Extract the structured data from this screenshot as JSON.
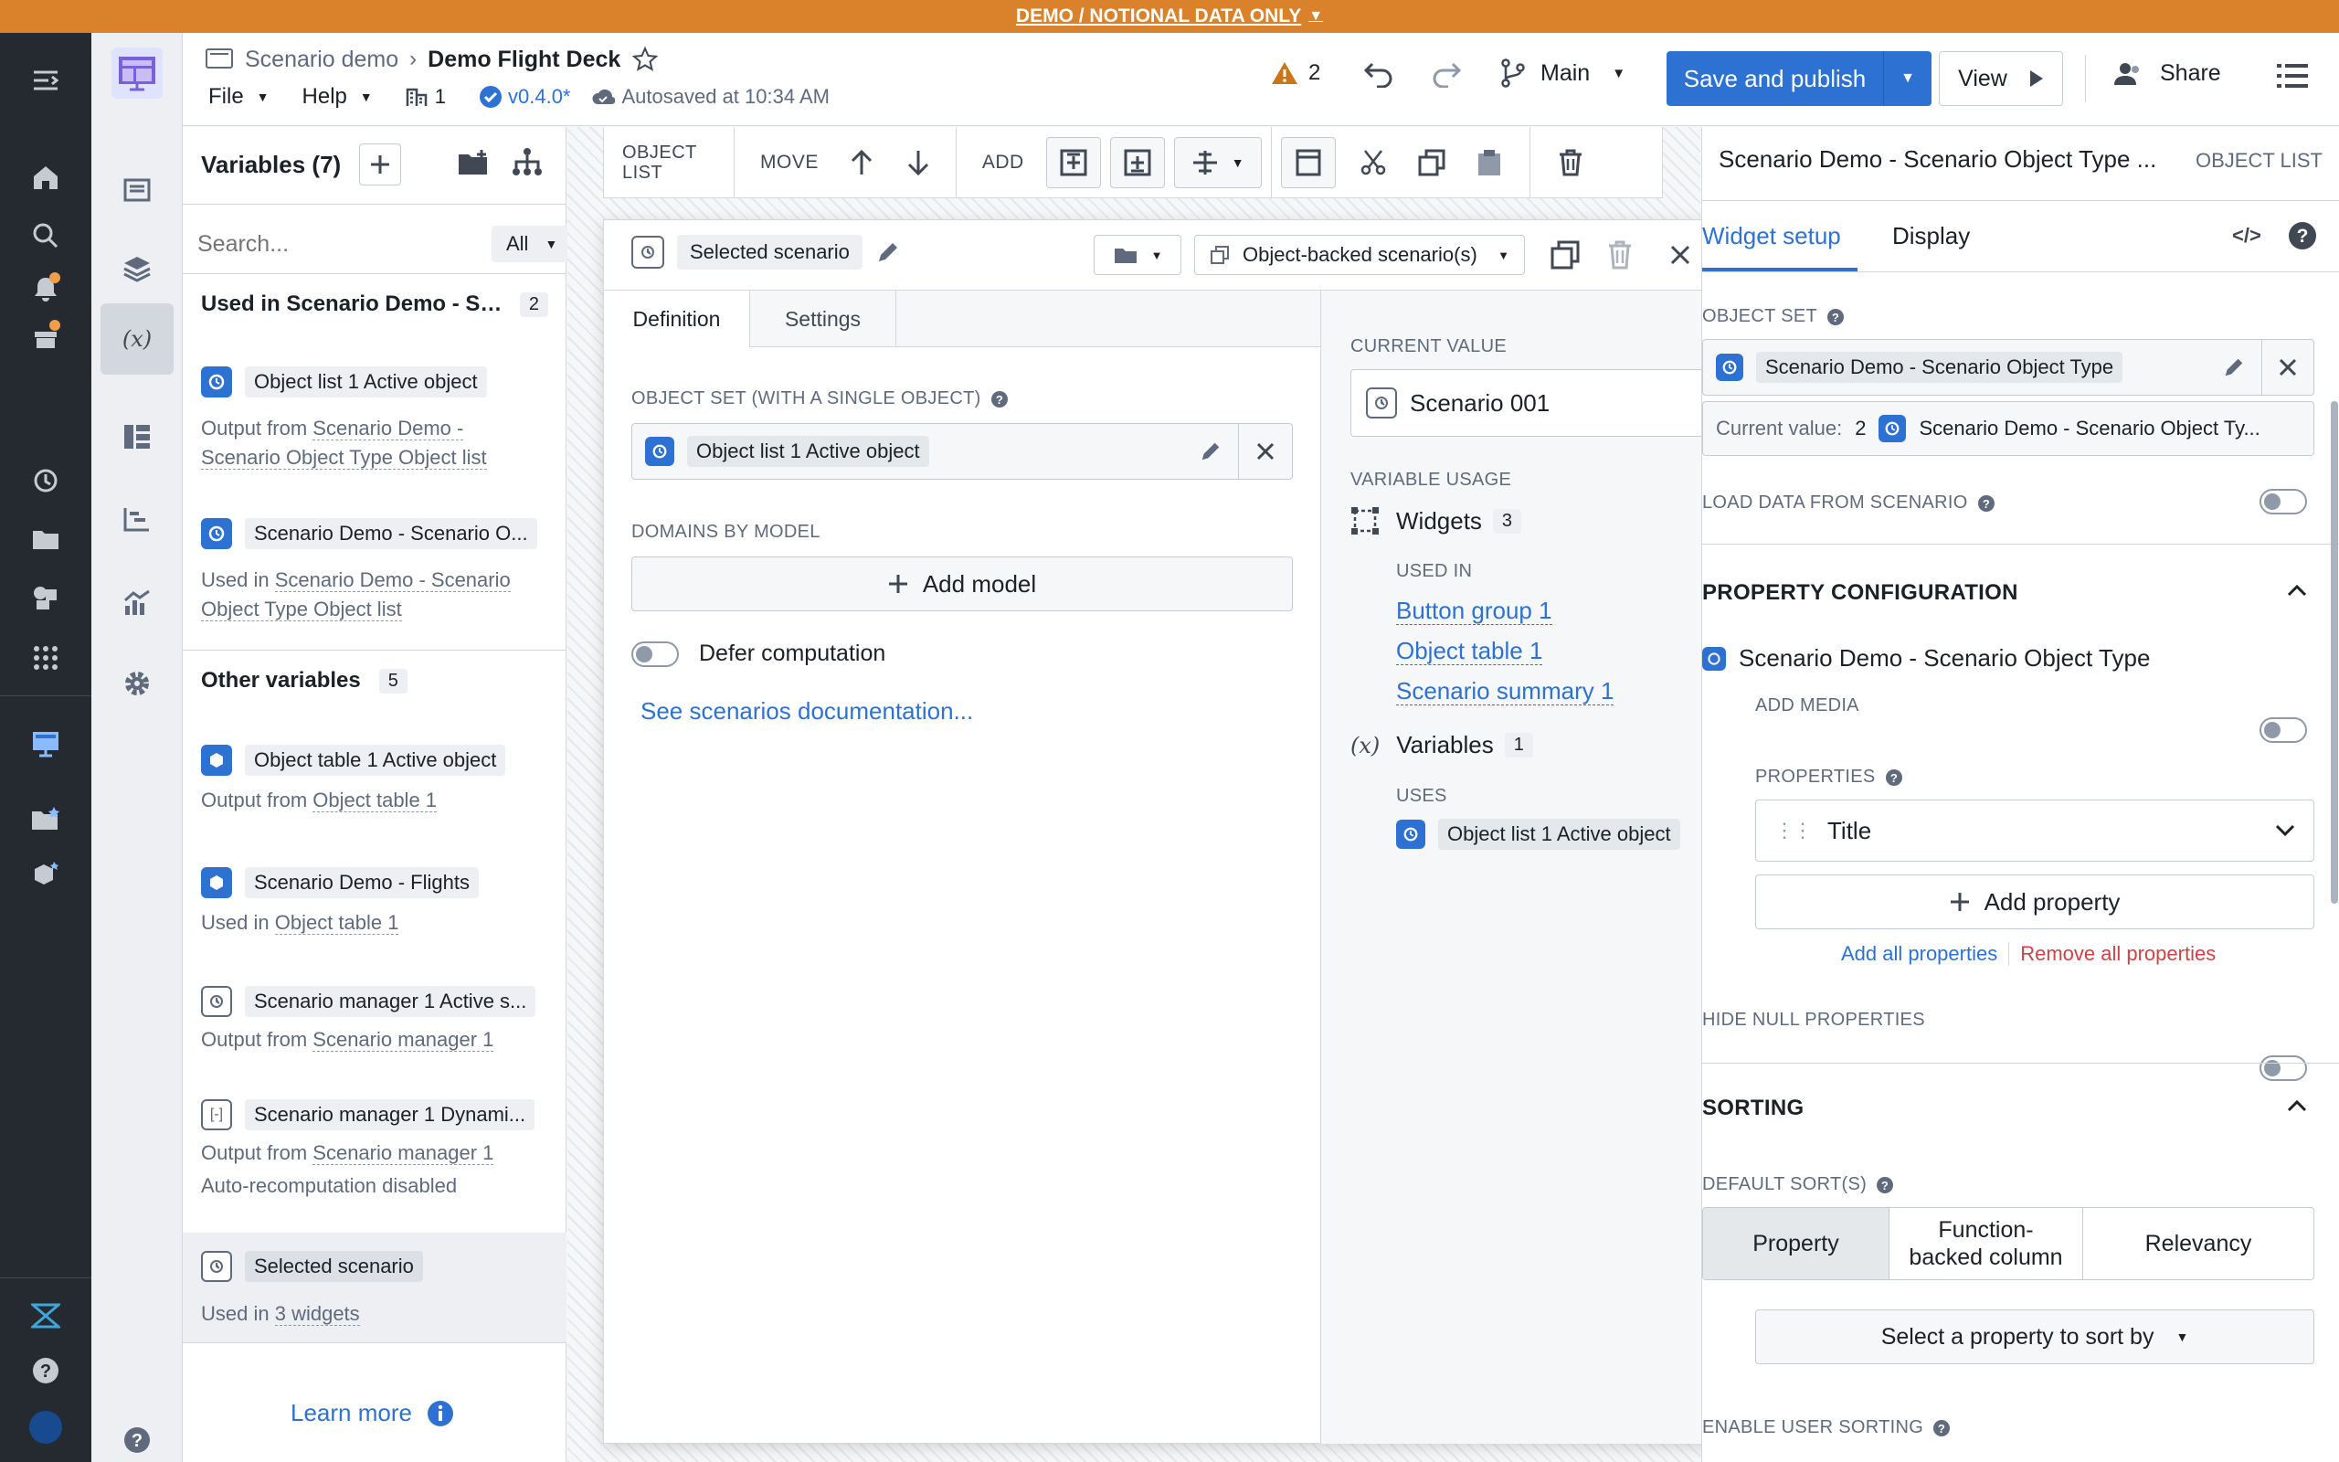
{
  "banner": {
    "label": "DEMO / NOTIONAL DATA ONLY"
  },
  "header": {
    "breadcrumb_parent": "Scenario demo",
    "title": "Demo Flight Deck",
    "menu_file": "File",
    "menu_help": "Help",
    "page_count": "1",
    "version": "v0.4.0*",
    "autosave": "Autosaved at 10:34 AM",
    "warning_count": "2",
    "branch": "Main",
    "save_label": "Save and publish",
    "view_label": "View",
    "share_label": "Share"
  },
  "left_panel": {
    "title": "Variables (7)",
    "search_placeholder": "Search...",
    "filter": "All",
    "used_section": {
      "title": "Used in Scenario Demo - Sc...",
      "count": "2"
    },
    "used_items": [
      {
        "name": "Object list 1 Active object",
        "meta_prefix": "Output from",
        "meta_link": "Scenario Demo - Scenario Object Type Object list"
      },
      {
        "name": "Scenario Demo - Scenario O...",
        "meta_prefix": "Used in",
        "meta_link": "Scenario Demo - Scenario Object Type Object list"
      }
    ],
    "other_section": {
      "title": "Other variables",
      "count": "5"
    },
    "other_items": [
      {
        "name": "Object table 1 Active object",
        "meta_prefix": "Output from",
        "meta_link": "Object table 1"
      },
      {
        "name": "Scenario Demo - Flights",
        "meta_prefix": "Used in",
        "meta_link": "Object table 1"
      },
      {
        "name": "Scenario manager 1 Active s...",
        "meta_prefix": "Output from",
        "meta_link": "Scenario manager 1"
      },
      {
        "name": "Scenario manager 1 Dynami...",
        "meta_prefix": "Output from",
        "meta_link": "Scenario manager 1",
        "extra": "Auto-recomputation disabled"
      },
      {
        "name": "Selected scenario",
        "meta_prefix": "Used in",
        "meta_link": "3 widgets"
      }
    ],
    "learn_more": "Learn more"
  },
  "toolbar": {
    "object_list": "OBJECT LIST",
    "move": "MOVE",
    "add": "ADD"
  },
  "dialog": {
    "variable_name": "Selected scenario",
    "type_select": "Object-backed scenario(s)",
    "tab_definition": "Definition",
    "tab_settings": "Settings",
    "object_set_label": "OBJECT SET (WITH A SINGLE OBJECT)",
    "object_set_value": "Object list 1 Active object",
    "domains_label": "DOMAINS BY MODEL",
    "add_model": "Add model",
    "defer": "Defer computation",
    "docs_link": "See scenarios documentation...",
    "current_value_label": "CURRENT VALUE",
    "current_value": "Scenario 001",
    "usage_label": "VARIABLE USAGE",
    "widgets_label": "Widgets",
    "widgets_count": "3",
    "used_in_label": "USED IN",
    "widget_links": [
      "Button group 1",
      "Object table 1",
      "Scenario summary 1"
    ],
    "variables_label": "Variables",
    "variables_count": "1",
    "uses_label": "USES",
    "uses_item": "Object list 1 Active object"
  },
  "right_panel": {
    "title": "Scenario Demo - Scenario Object Type ...",
    "type_label": "OBJECT LIST",
    "tab_setup": "Widget setup",
    "tab_display": "Display",
    "object_set_label": "OBJECT SET",
    "object_set_value": "Scenario Demo - Scenario Object Type",
    "current_value_label": "Current value:",
    "current_value_count": "2",
    "current_value_text": "Scenario Demo - Scenario Object Ty...",
    "load_data_label": "LOAD DATA FROM SCENARIO",
    "property_config_label": "PROPERTY CONFIGURATION",
    "object_type_name": "Scenario Demo - Scenario Object Type",
    "add_media_label": "ADD MEDIA",
    "properties_label": "PROPERTIES",
    "property_title": "Title",
    "add_property": "Add property",
    "add_all": "Add all properties",
    "remove_all": "Remove all properties",
    "hide_null_label": "HIDE NULL PROPERTIES",
    "sorting_label": "SORTING",
    "default_sort_label": "DEFAULT SORT(S)",
    "sort_options": [
      "Property",
      "Function-backed column",
      "Relevancy"
    ],
    "sort_select": "Select a property to sort by",
    "enable_sorting_label": "ENABLE USER SORTING"
  },
  "colors": {
    "banner": "#d9822b",
    "primary": "#2d72d2",
    "rail": "#252a31",
    "danger": "#cd4246"
  }
}
